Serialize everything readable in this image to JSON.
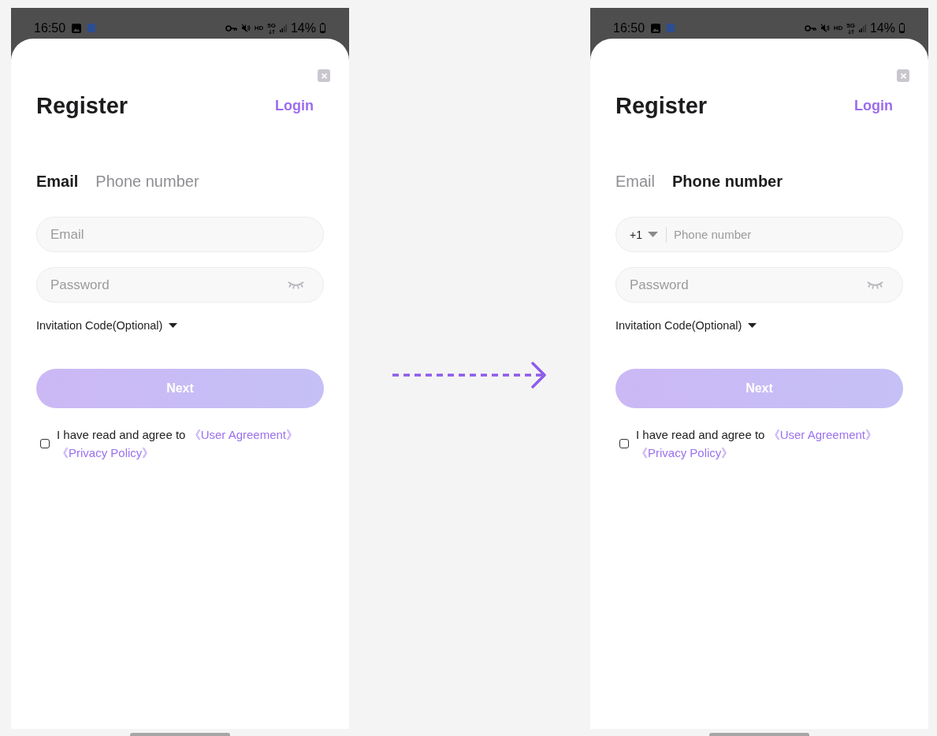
{
  "screens": [
    {
      "status_bar": {
        "time": "16:50",
        "hd_label": "HD",
        "network_label": "5G",
        "battery": "14%"
      },
      "title": "Register",
      "login_link": "Login",
      "tabs": [
        {
          "label": "Email",
          "selected": true
        },
        {
          "label": "Phone number",
          "selected": false
        }
      ],
      "fields": [
        {
          "kind": "email",
          "placeholder": "Email"
        },
        {
          "kind": "password",
          "placeholder": "Password"
        }
      ],
      "invitation_code": {
        "label": "Invitation Code(Optional)",
        "expanded": false
      },
      "next_button": {
        "label": "Next",
        "disabled": true
      },
      "agreement": {
        "checked": false,
        "text": "I have read and agree to",
        "links": [
          "《User Agreement》",
          "《Privacy Policy》"
        ]
      }
    },
    {
      "status_bar": {
        "time": "16:50",
        "hd_label": "HD",
        "network_label": "5G",
        "battery": "14%"
      },
      "title": "Register",
      "login_link": "Login",
      "tabs": [
        {
          "label": "Email",
          "selected": false
        },
        {
          "label": "Phone number",
          "selected": true
        }
      ],
      "fields": [
        {
          "kind": "phone",
          "country_code": "+1",
          "placeholder": "Phone number"
        },
        {
          "kind": "password",
          "placeholder": "Password"
        }
      ],
      "invitation_code": {
        "label": "Invitation Code(Optional)",
        "expanded": false
      },
      "next_button": {
        "label": "Next",
        "disabled": true
      },
      "agreement": {
        "checked": false,
        "text": "I have read and agree to",
        "links": [
          "《User Agreement》",
          "《Privacy Policy》"
        ]
      }
    }
  ]
}
